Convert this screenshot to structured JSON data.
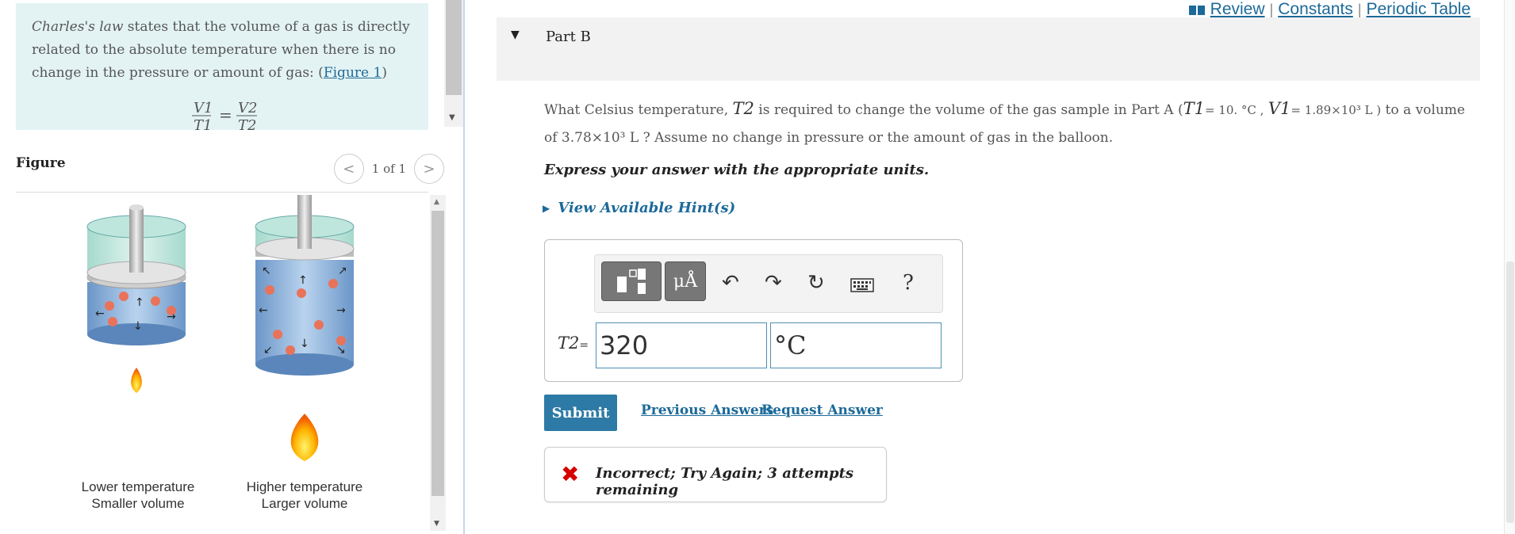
{
  "intro": {
    "term": "Charles's law",
    "text": " states that the volume of a gas is directly related to the absolute temperature when there is no change in the pressure or amount of gas: (",
    "link": "Figure 1",
    "close": ")",
    "equation": "V1/T1 = V2/T2"
  },
  "figure": {
    "title": "Figure",
    "prev": "<",
    "count": "1 of 1",
    "next": ">",
    "captions": [
      {
        "line1": "Lower temperature",
        "line2": "Smaller volume"
      },
      {
        "line1": "Higher temperature",
        "line2": "Larger volume"
      }
    ]
  },
  "header_links": {
    "review": "Review",
    "constants": "Constants",
    "periodic": "Periodic Table",
    "sep": "|"
  },
  "part": {
    "title": "Part B"
  },
  "question": {
    "pre": "What Celsius temperature, ",
    "t2": "T2",
    "mid": " is required to change the volume of the gas sample in Part A (",
    "t1": "T1",
    "t1_val": "= 10. °C ,",
    "v1": "V1",
    "v1_val": "= 1.89×10³ L )",
    "tail": " to a volume of 3.78×10³ L ? Assume no change in pressure or the amount of gas in the balloon."
  },
  "instructions": "Express your answer with the appropriate units.",
  "hints": "View Available Hint(s)",
  "toolbar": {
    "units_label": "μÅ",
    "help": "?"
  },
  "answer": {
    "label": "T2",
    "eq": "=",
    "value": "320",
    "unit": "°C"
  },
  "actions": {
    "submit": "Submit",
    "previous": "Previous Answers",
    "request": "Request Answer"
  },
  "feedback": {
    "text": "Incorrect; Try Again; 3 attempts remaining"
  },
  "colors": {
    "accent": "#2d7aa6",
    "link": "#1d6a99",
    "intro_bg": "#e3f3f3",
    "error": "#d60000"
  }
}
